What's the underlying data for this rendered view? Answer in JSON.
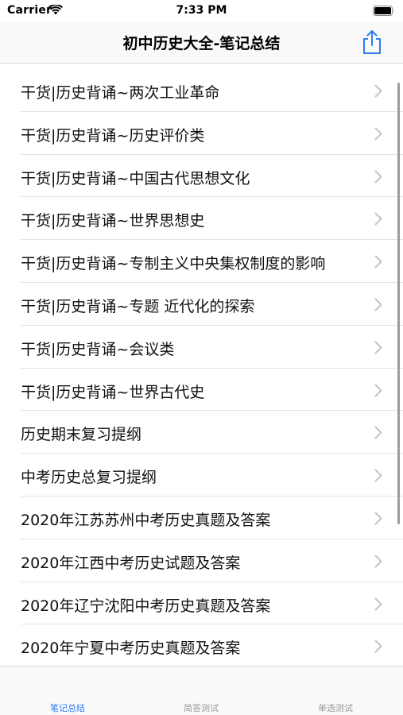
{
  "status_bar": {
    "carrier": "Carrier",
    "time": "7:33 PM"
  },
  "nav": {
    "title": "初中历史大全-笔记总结",
    "share_icon": "share-icon",
    "accent_color": "#2f7cf6"
  },
  "list": {
    "items": [
      {
        "label": "干货|历史背诵~两次工业革命"
      },
      {
        "label": "干货|历史背诵~历史评价类"
      },
      {
        "label": "干货|历史背诵~中国古代思想文化"
      },
      {
        "label": "干货|历史背诵~世界思想史"
      },
      {
        "label": "干货|历史背诵~专制主义中央集权制度的影响"
      },
      {
        "label": "干货|历史背诵~专题 近代化的探索"
      },
      {
        "label": "干货|历史背诵~会议类"
      },
      {
        "label": "干货|历史背诵~世界古代史"
      },
      {
        "label": "历史期末复习提纲"
      },
      {
        "label": "中考历史总复习提纲"
      },
      {
        "label": "2020年江苏苏州中考历史真题及答案"
      },
      {
        "label": "2020年江西中考历史试题及答案"
      },
      {
        "label": "2020年辽宁沈阳中考历史真题及答案"
      },
      {
        "label": "2020年宁夏中考历史真题及答案"
      }
    ]
  },
  "tab_bar": {
    "tabs": [
      {
        "label": "笔记总结",
        "selected": true
      },
      {
        "label": "简答测试",
        "selected": false
      },
      {
        "label": "单选测试",
        "selected": false
      }
    ],
    "selected_color": "#2f7cf6",
    "unselected_color": "#9a9a9a"
  }
}
